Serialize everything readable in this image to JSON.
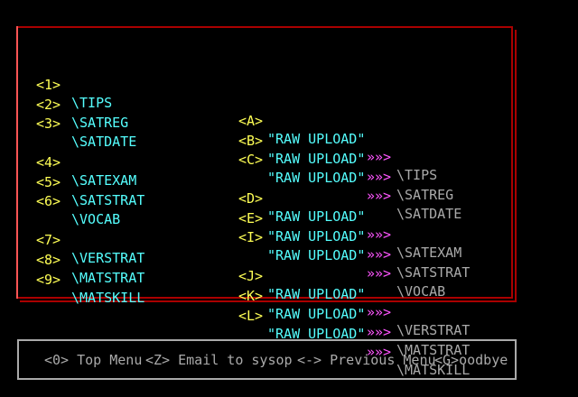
{
  "menu_rows": [
    {
      "key": "<1>",
      "name": "\\TIPS",
      "upkey": "<A>",
      "upload": "\"RAW UPLOAD\"",
      "arrow": "»»>",
      "dest": "\\TIPS"
    },
    {
      "key": "<2>",
      "name": "\\SATREG",
      "upkey": "<B>",
      "upload": "\"RAW UPLOAD\"",
      "arrow": "»»>",
      "dest": "\\SATREG"
    },
    {
      "key": "<3>",
      "name": "\\SATDATE",
      "upkey": "<C>",
      "upload": "\"RAW UPLOAD\"",
      "arrow": "»»>",
      "dest": "\\SATDATE"
    },
    {
      "key": "<4>",
      "name": "\\SATEXAM",
      "upkey": "<D>",
      "upload": "\"RAW UPLOAD\"",
      "arrow": "»»>",
      "dest": "\\SATEXAM"
    },
    {
      "key": "<5>",
      "name": "\\SATSTRAT",
      "upkey": "<E>",
      "upload": "\"RAW UPLOAD\"",
      "arrow": "»»>",
      "dest": "\\SATSTRAT"
    },
    {
      "key": "<6>",
      "name": "\\VOCAB",
      "upkey": "<I>",
      "upload": "\"RAW UPLOAD\"",
      "arrow": "»»>",
      "dest": "\\VOCAB"
    },
    {
      "key": "<7>",
      "name": "\\VERSTRAT",
      "upkey": "<J>",
      "upload": "\"RAW UPLOAD\"",
      "arrow": "»»>",
      "dest": "\\VERSTRAT"
    },
    {
      "key": "<8>",
      "name": "\\MATSTRAT",
      "upkey": "<K>",
      "upload": "\"RAW UPLOAD\"",
      "arrow": "»»>",
      "dest": "\\MATSTRAT"
    },
    {
      "key": "<9>",
      "name": "\\MATSKILL",
      "upkey": "<L>",
      "upload": "\"RAW UPLOAD\"",
      "arrow": "»»>",
      "dest": "\\MATSKILL"
    }
  ],
  "bottom_menu": {
    "top_menu": "<0> Top Menu",
    "email": "<Z> Email to sysop",
    "previous": "<-> Previous Menu",
    "goodbye": "<G>oodbye"
  },
  "colors": {
    "background": "#000000",
    "frame": "#aa0000",
    "key": "#ffff55",
    "name": "#55ffff",
    "arrow": "#ff55ff",
    "dest": "#aaaaaa",
    "menu_border": "#aaaaaa"
  }
}
